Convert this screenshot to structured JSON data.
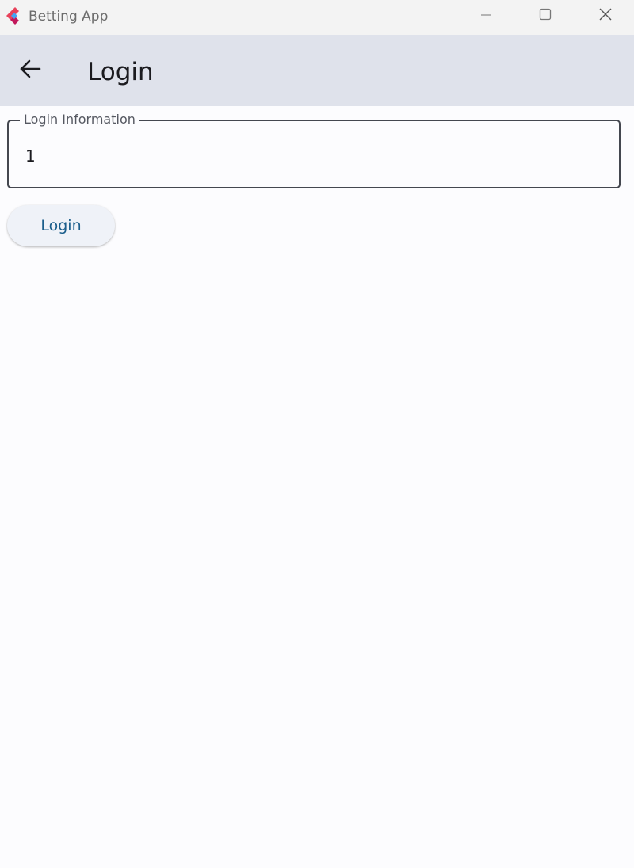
{
  "window": {
    "title": "Betting App",
    "icon": "flutter-logo-icon",
    "controls": [
      "minimize-icon",
      "maximize-icon",
      "close-icon"
    ]
  },
  "appbar": {
    "back_icon": "arrow-left-icon",
    "title": "Login"
  },
  "form": {
    "login_field": {
      "label": "Login Information",
      "value": "1"
    },
    "login_button": {
      "label": "Login"
    }
  },
  "colors": {
    "titlebar_bg": "#f3f3f3",
    "appbar_bg": "#dfe2eb",
    "page_bg": "#fcfcfe",
    "button_text": "#1b5e8c",
    "field_border": "#44474f"
  }
}
